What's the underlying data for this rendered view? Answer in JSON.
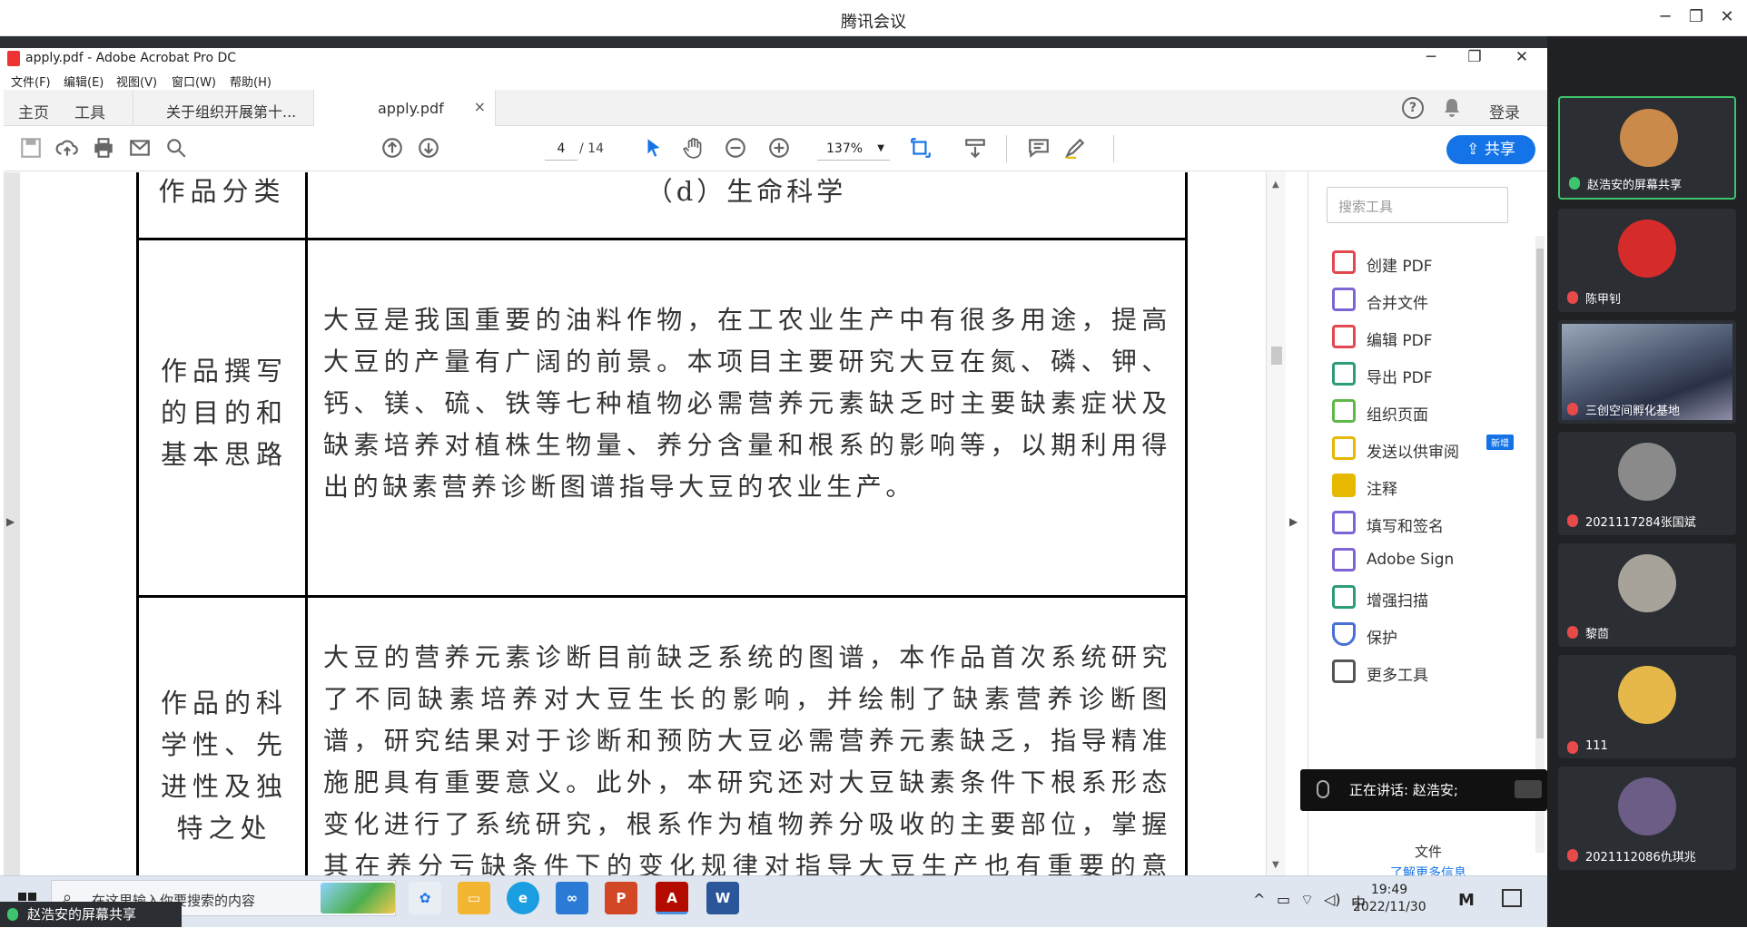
{
  "meeting": {
    "title": "腾讯会议",
    "min": "─",
    "restore": "❐",
    "close": "✕",
    "share_label": "赵浩安的屏幕共享",
    "speaking": "正在讲话: 赵浩安;",
    "participants": [
      {
        "name": "赵浩安的屏幕共享",
        "mic": "on",
        "avatar_color": "#c98a4a"
      },
      {
        "name": "陈甲钊",
        "mic": "off",
        "avatar_color": "#d62b2b"
      },
      {
        "name": "三创空间孵化基地",
        "mic": "off",
        "video": true
      },
      {
        "name": "2021117284张国斌",
        "mic": "off",
        "avatar_color": "#8a8a8a"
      },
      {
        "name": "黎茴",
        "mic": "off",
        "avatar_color": "#a7a39a"
      },
      {
        "name": "111",
        "mic": "off",
        "avatar_color": "#e6b84a"
      },
      {
        "name": "2021112086仇琪兆",
        "mic": "off",
        "avatar_color": "#6b5d86"
      }
    ]
  },
  "acrobat": {
    "window_title": "apply.pdf - Adobe Acrobat Pro DC",
    "menu": [
      "文件(F)",
      "编辑(E)",
      "视图(V)",
      "窗口(W)",
      "帮助(H)"
    ],
    "nav_home": "主页",
    "nav_tools": "工具",
    "tabs": [
      {
        "label": "关于组织开展第十...",
        "active": false
      },
      {
        "label": "apply.pdf",
        "active": true,
        "close": "×"
      }
    ],
    "login": "登录",
    "page_current": "4",
    "page_total": "/ 14",
    "zoom": "137%",
    "share_button": "共享",
    "tools_search_placeholder": "搜索工具",
    "tools": [
      {
        "label": "创建 PDF",
        "color": "#e34850"
      },
      {
        "label": "合并文件",
        "color": "#7f64d6"
      },
      {
        "label": "编辑 PDF",
        "color": "#e34850"
      },
      {
        "label": "导出 PDF",
        "color": "#2d9d78"
      },
      {
        "label": "组织页面",
        "color": "#5fb84b"
      },
      {
        "label": "发送以供审阅",
        "color": "#e6b800",
        "badge": "新增"
      },
      {
        "label": "注释",
        "color": "#e6b800"
      },
      {
        "label": "填写和签名",
        "color": "#7f64d6"
      },
      {
        "label": "Adobe Sign",
        "color": "#7f64d6"
      },
      {
        "label": "增强扫描",
        "color": "#2d9d78"
      },
      {
        "label": "保护",
        "color": "#4a6fd6"
      },
      {
        "label": "更多工具",
        "color": "#555555"
      }
    ],
    "tools_footer_1": "文件",
    "tools_footer_2": "了解更多信息"
  },
  "document": {
    "row1_label": "作品分类",
    "row1_value": "（d）生命科学",
    "row2_label": "作品撰写的目的和基本思路",
    "row2_text": "大豆是我国重要的油料作物，在工农业生产中有很多用途，提高大豆的产量有广阔的前景。本项目主要研究大豆在氮、磷、钾、钙、镁、硫、铁等七种植物必需营养元素缺乏时主要缺素症状及缺素培养对植株生物量、养分含量和根系的影响等，以期利用得出的缺素营养诊断图谱指导大豆的农业生产。",
    "row3_label": "作品的科学性、先进性及独特之处",
    "row3_text": "大豆的营养元素诊断目前缺乏系统的图谱，本作品首次系统研究了不同缺素培养对大豆生长的影响，并绘制了缺素营养诊断图谱，研究结果对于诊断和预防大豆必需营养元素缺乏，指导精准施肥具有重要意义。此外，本研究还对大豆缺素条件下根系形态变化进行了系统研究，根系作为植物养分吸收的主要部位，掌握其在养分亏缺条件下的变化规律对指导大豆生产也有重要的意义。"
  },
  "taskbar": {
    "search_placeholder": "在这里输入你要搜索的内容",
    "ime": "中",
    "time": "19:49",
    "date": "2022/11/30"
  }
}
